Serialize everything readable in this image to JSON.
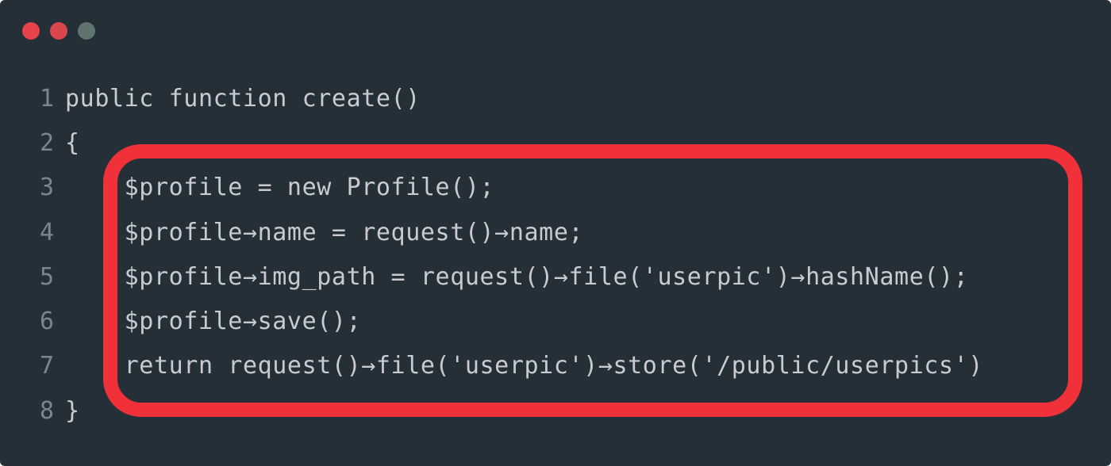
{
  "window": {
    "controls": [
      {
        "name": "close",
        "color": "#e8424a"
      },
      {
        "name": "minimize",
        "color": "#d9474c"
      },
      {
        "name": "maximize",
        "color": "#5f7470"
      }
    ]
  },
  "code": {
    "lines": [
      {
        "number": "1",
        "text": "public function create()"
      },
      {
        "number": "2",
        "text": "{"
      },
      {
        "number": "3",
        "text": "    $profile = new Profile();"
      },
      {
        "number": "4",
        "text": "    $profile→name = request()→name;"
      },
      {
        "number": "5",
        "text": "    $profile→img_path = request()→file('userpic')→hashName();"
      },
      {
        "number": "6",
        "text": "    $profile→save();"
      },
      {
        "number": "7",
        "text": "    return request()→file('userpic')→store('/public/userpics')"
      },
      {
        "number": "8",
        "text": "}"
      }
    ]
  },
  "highlight": {
    "color": "#f0313a",
    "first_line": "3",
    "last_line": "7"
  }
}
